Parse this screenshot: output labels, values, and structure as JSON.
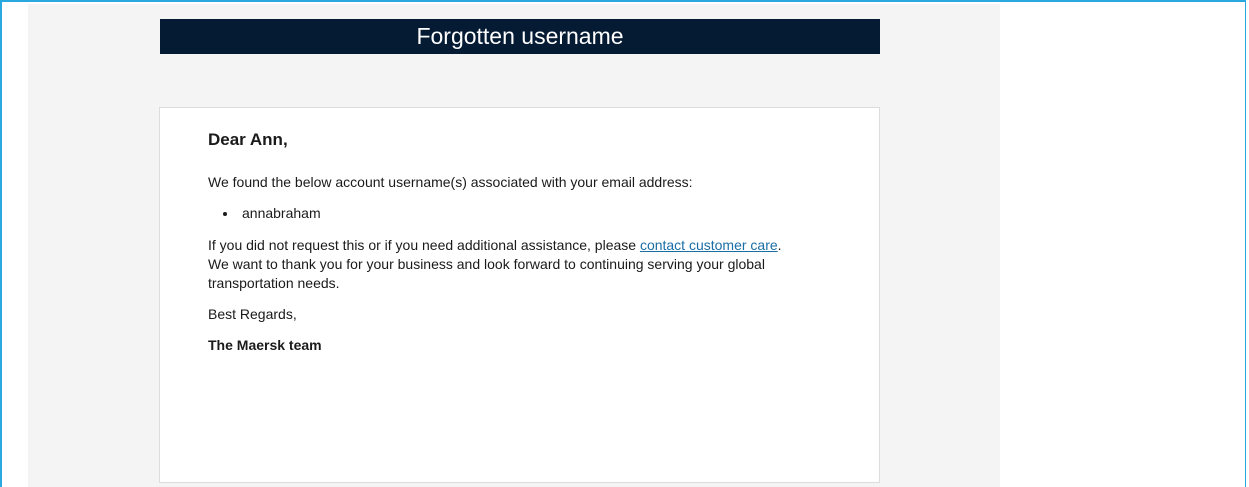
{
  "email": {
    "header_title": "Forgotten username",
    "greeting": "Dear Ann,",
    "intro_text": "We found the below account username(s) associated with your email address:",
    "usernames": [
      "annabraham"
    ],
    "help_text_before": "If you did not request this or if you need additional assistance, please ",
    "help_link": "contact customer care",
    "help_text_after": ".",
    "thanks_text": "We want to thank you for your business and look forward to continuing serving your global transportation needs.",
    "regards": "Best Regards,",
    "signature": "The Maersk team"
  },
  "colors": {
    "header_bg": "#041b33",
    "link": "#1a6ea6",
    "frame_border": "#29a8e0",
    "email_bg": "#f4f4f4"
  }
}
